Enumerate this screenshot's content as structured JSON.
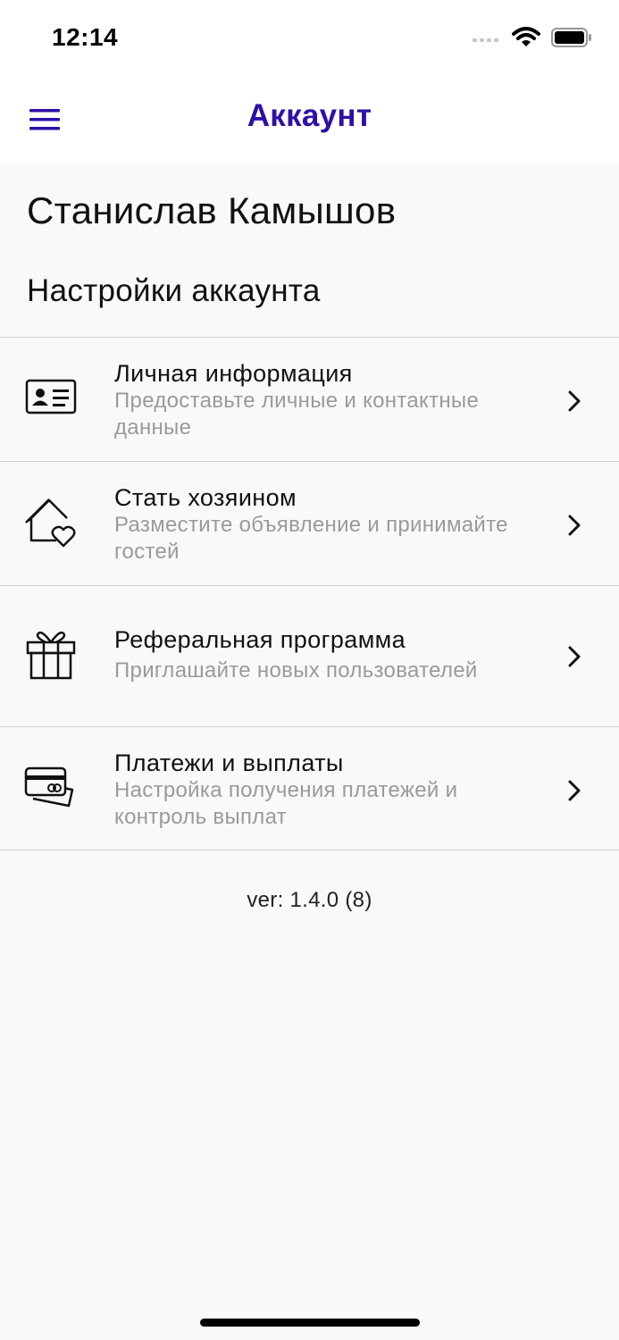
{
  "status_bar": {
    "time": "12:14",
    "icons": [
      "cellular-signal-icon",
      "wifi-icon",
      "battery-icon"
    ]
  },
  "nav": {
    "menu_icon": "hamburger-menu-icon",
    "title": "Аккаунт",
    "title_color": "#2e0fa8"
  },
  "profile": {
    "name": "Станислав Камышов"
  },
  "settings": {
    "section_title": "Настройки аккаунта",
    "items": [
      {
        "icon": "id-card-icon",
        "title": "Личная информация",
        "subtitle": "Предоставьте личные и контактные данные"
      },
      {
        "icon": "house-heart-icon",
        "title": "Стать хозяином",
        "subtitle": "Разместите объявление и принимайте гостей"
      },
      {
        "icon": "gift-icon",
        "title": "Реферальная программа",
        "subtitle": "Приглашайте новых пользователей"
      },
      {
        "icon": "credit-cards-icon",
        "title": "Платежи и выплаты",
        "subtitle": "Настройка получения платежей и контроль выплат"
      }
    ]
  },
  "footer": {
    "version": "ver: 1.4.0 (8)"
  }
}
